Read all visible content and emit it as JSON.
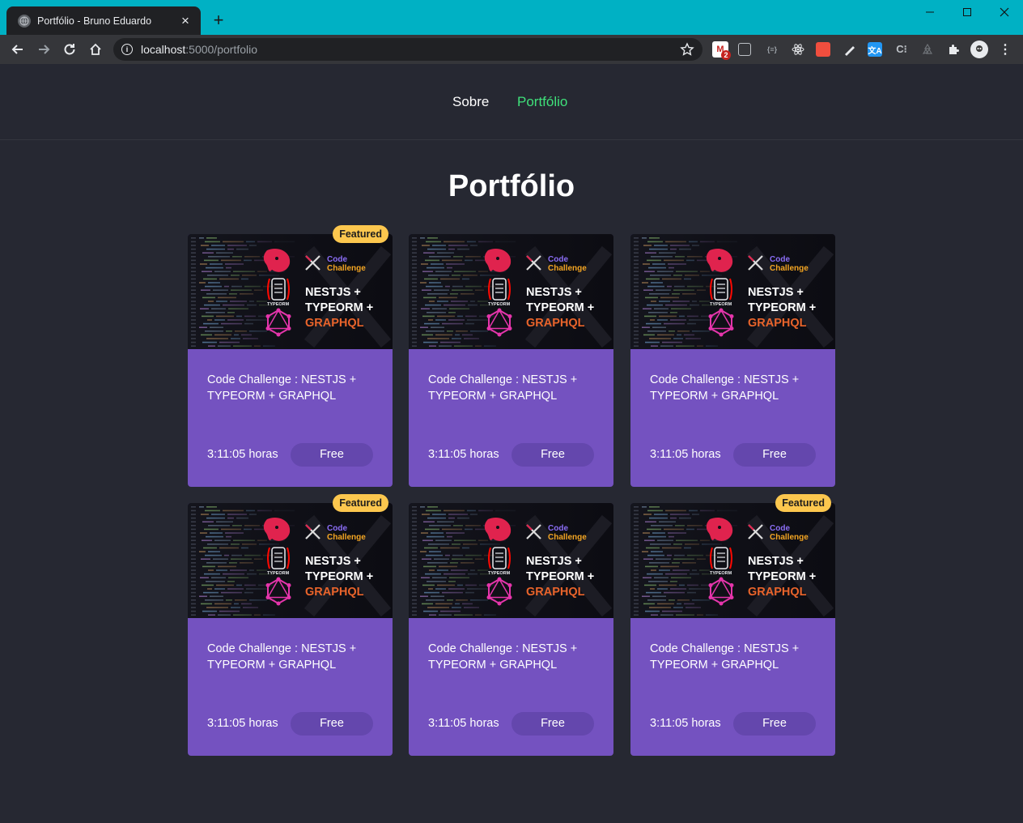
{
  "browser": {
    "tab_title": "Portfólio - Bruno Eduardo",
    "url_host": "localhost",
    "url_rest": ":5000/portfolio"
  },
  "nav": {
    "items": [
      {
        "label": "Sobre",
        "active": false
      },
      {
        "label": "Portfólio",
        "active": true
      }
    ]
  },
  "page": {
    "title": "Portfólio"
  },
  "thumbnail": {
    "code_label": "Code",
    "challenge_label": "Challenge",
    "line1": "NESTJS +",
    "line2": "TYPEORM +",
    "line3": "GRAPHQL",
    "typeorm_label": "TYPEORM"
  },
  "cards": [
    {
      "title": "Code Challenge : NESTJS + TYPEORM + GRAPHQL",
      "duration": "3:11:05 horas",
      "price": "Free",
      "badge": "Featured"
    },
    {
      "title": "Code Challenge : NESTJS + TYPEORM + GRAPHQL",
      "duration": "3:11:05 horas",
      "price": "Free",
      "badge": ""
    },
    {
      "title": "Code Challenge : NESTJS + TYPEORM + GRAPHQL",
      "duration": "3:11:05 horas",
      "price": "Free",
      "badge": ""
    },
    {
      "title": "Code Challenge : NESTJS + TYPEORM + GRAPHQL",
      "duration": "3:11:05 horas",
      "price": "Free",
      "badge": "Featured"
    },
    {
      "title": "Code Challenge : NESTJS + TYPEORM + GRAPHQL",
      "duration": "3:11:05 horas",
      "price": "Free",
      "badge": ""
    },
    {
      "title": "Code Challenge : NESTJS + TYPEORM + GRAPHQL",
      "duration": "3:11:05 horas",
      "price": "Free",
      "badge": "Featured"
    }
  ],
  "extensions": {
    "gmail_count": "2"
  },
  "colors": {
    "page_bg": "#262832",
    "card_bg": "#7452c0",
    "button_bg": "#6447ad",
    "badge_bg": "#fcc74e",
    "nav_active": "#3fe07a",
    "titlebar": "#00b1c4"
  }
}
